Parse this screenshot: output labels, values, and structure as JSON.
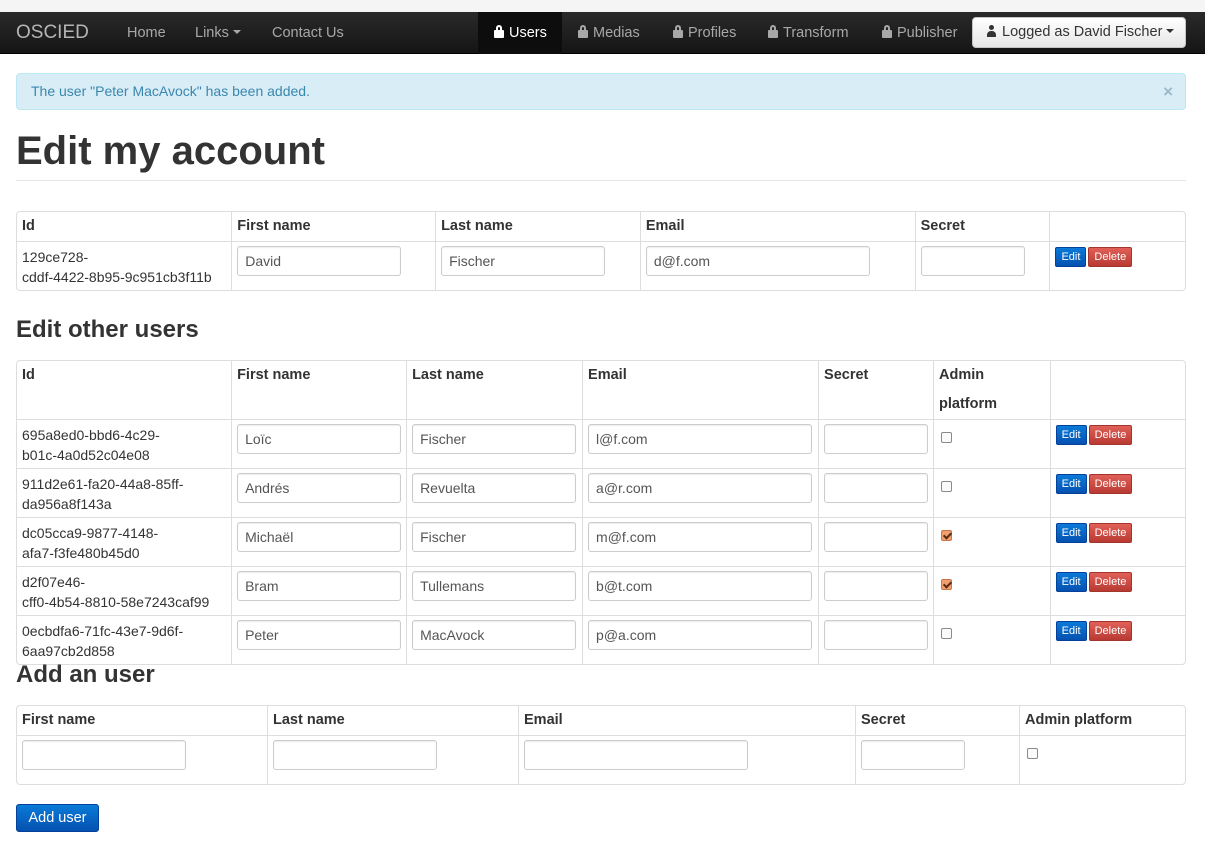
{
  "navbar": {
    "brand": "OSCIED",
    "home": "Home",
    "links": "Links",
    "contact": "Contact Us",
    "users": "Users",
    "medias": "Medias",
    "profiles": "Profiles",
    "transform": "Transform",
    "publisher": "Publisher",
    "logged_as": "Logged as David Fischer"
  },
  "alert": {
    "message": "The user \"Peter MacAvock\" has been added.",
    "close": "×"
  },
  "page_title": "Edit my account",
  "my_account": {
    "headers": [
      "Id",
      "First name",
      "Last name",
      "Email",
      "Secret"
    ],
    "row": {
      "id_line1": "129ce728-",
      "id_line2": "cddf-4422-8b95-9c951cb3f11b",
      "first_name": "David",
      "last_name": "Fischer",
      "email": "d@f.com",
      "secret": ""
    }
  },
  "other_users": {
    "title": "Edit other users",
    "headers": [
      "Id",
      "First name",
      "Last name",
      "Email",
      "Secret",
      "Admin platform"
    ],
    "rows": [
      {
        "id_line1": "695a8ed0-bbd6-4c29-",
        "id_line2": "b01c-4a0d52c04e08",
        "first_name": "Loïc",
        "last_name": "Fischer",
        "email": "l@f.com",
        "secret": "",
        "admin": false
      },
      {
        "id_line1": "911d2e61-fa20-44a8-85ff-",
        "id_line2": "da956a8f143a",
        "first_name": "Andrés",
        "last_name": "Revuelta",
        "email": "a@r.com",
        "secret": "",
        "admin": false
      },
      {
        "id_line1": "dc05cca9-9877-4148-",
        "id_line2": "afa7-f3fe480b45d0",
        "first_name": "Michaël",
        "last_name": "Fischer",
        "email": "m@f.com",
        "secret": "",
        "admin": true
      },
      {
        "id_line1": "d2f07e46-",
        "id_line2": "cff0-4b54-8810-58e7243caf99",
        "first_name": "Bram",
        "last_name": "Tullemans",
        "email": "b@t.com",
        "secret": "",
        "admin": true
      },
      {
        "id_line1": "0ecbdfa6-71fc-43e7-9d6f-",
        "id_line2": "6aa97cb2d858",
        "first_name": "Peter",
        "last_name": "MacAvock",
        "email": "p@a.com",
        "secret": "",
        "admin": false
      }
    ]
  },
  "buttons": {
    "edit": "Edit",
    "delete": "Delete"
  },
  "add_user": {
    "title": "Add an user",
    "headers": [
      "First name",
      "Last name",
      "Email",
      "Secret",
      "Admin platform"
    ],
    "submit": "Add user"
  }
}
